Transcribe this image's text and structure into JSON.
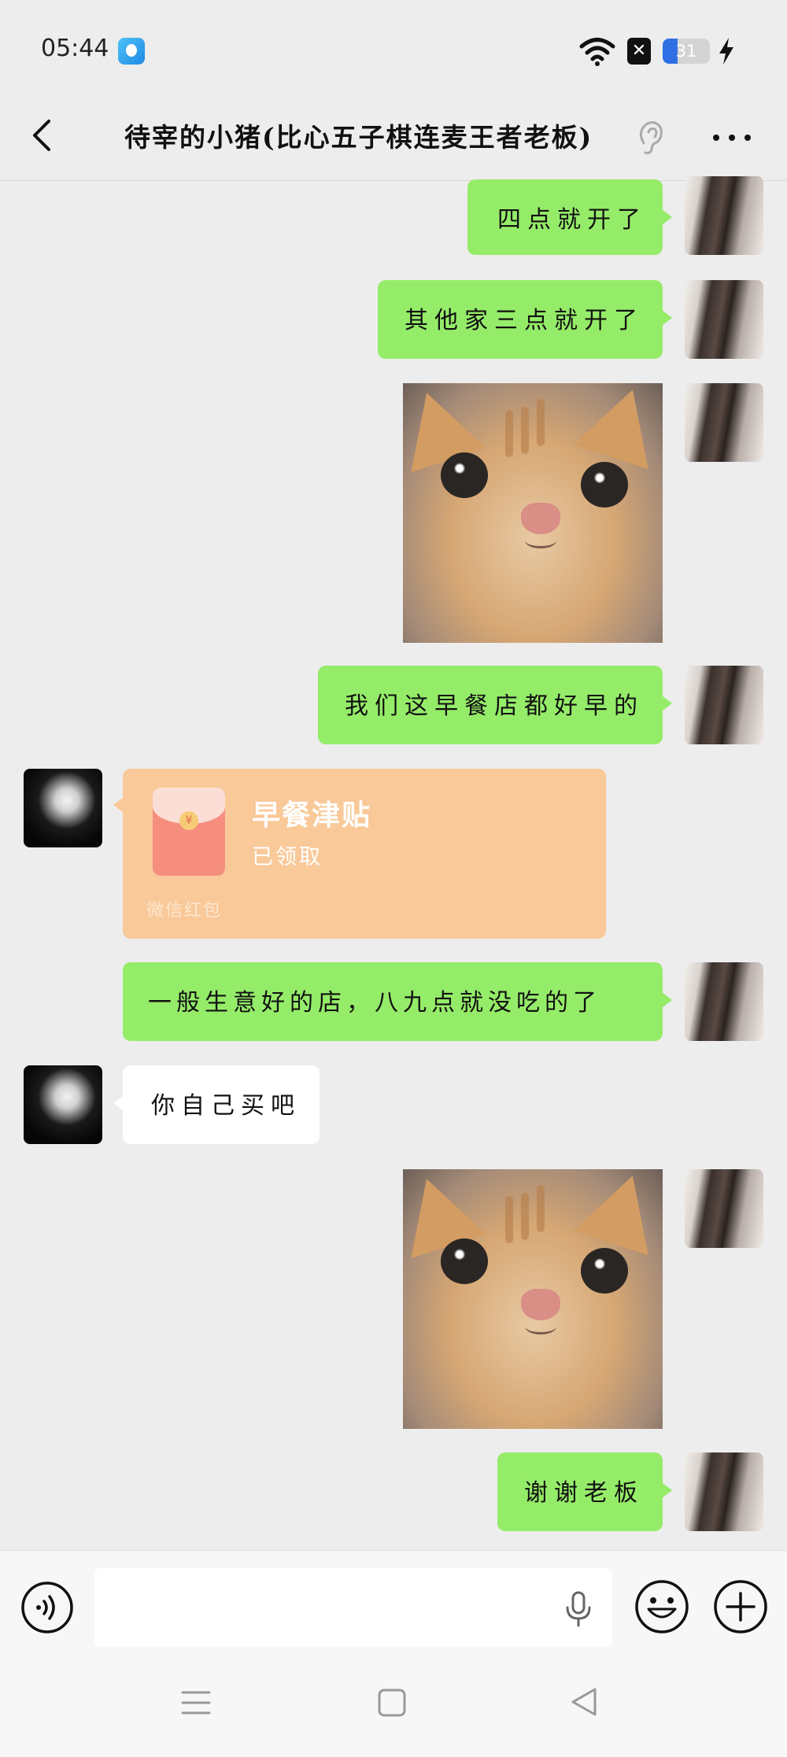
{
  "status_bar": {
    "time": "05:44",
    "battery_level": "31",
    "battery_fraction": 0.31
  },
  "header": {
    "title": "待宰的小猪(比心五子棋连麦王者老板)",
    "icons": [
      "back-icon",
      "ear-icon",
      "more-icon"
    ]
  },
  "messages": [
    {
      "sender": "self",
      "type": "text",
      "text": "四点就开了"
    },
    {
      "sender": "self",
      "type": "text",
      "text": "其他家三点就开了"
    },
    {
      "sender": "self",
      "type": "sticker",
      "sticker": "cat-face-sticker"
    },
    {
      "sender": "self",
      "type": "text",
      "text": "我们这早餐店都好早的"
    },
    {
      "sender": "friend",
      "type": "red_packet",
      "title": "早餐津贴",
      "status": "已领取",
      "footer": "微信红包"
    },
    {
      "sender": "self",
      "type": "text",
      "text": "一般生意好的店，八九点就没吃的了"
    },
    {
      "sender": "friend",
      "type": "text",
      "text": "你自己买吧"
    },
    {
      "sender": "self",
      "type": "sticker",
      "sticker": "cat-face-sticker"
    },
    {
      "sender": "self",
      "type": "text",
      "text": "谢谢老板"
    }
  ],
  "input_bar": {
    "placeholder": "",
    "icons": [
      "voice-icon",
      "mic-icon",
      "emoji-icon",
      "plus-icon"
    ]
  },
  "nav_bar": {
    "icons": [
      "menu-icon",
      "home-icon",
      "back-triangle-icon"
    ]
  },
  "colors": {
    "background": "#ededed",
    "self_bubble": "#95ec69",
    "friend_bubble": "#ffffff",
    "red_packet": "#f9c999"
  }
}
